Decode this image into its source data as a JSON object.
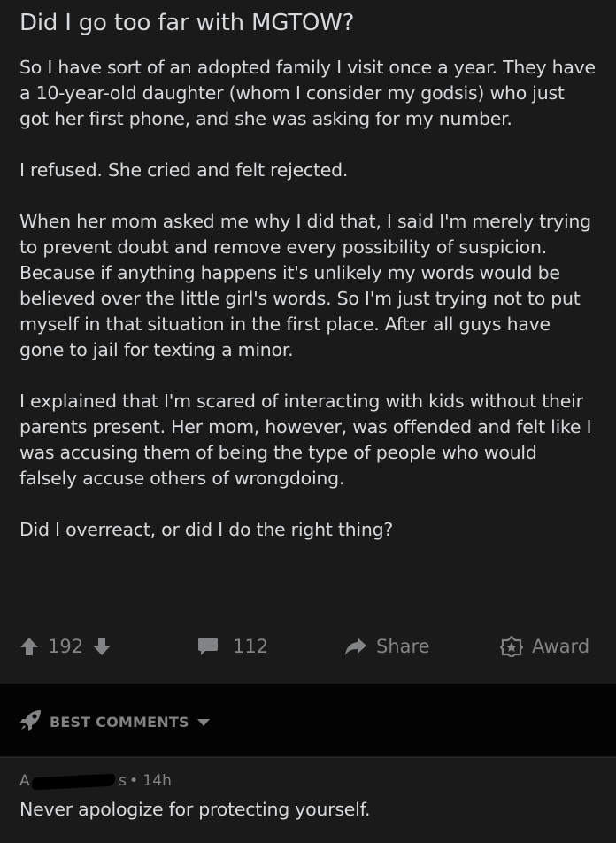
{
  "post": {
    "title": "Did I go too far with MGTOW?",
    "paragraphs": [
      "So I have sort of an adopted family I visit once a year. They have a 10-year-old daughter (whom I consider my godsis) who just got her first phone, and she was asking for my number.",
      "I refused. She cried and felt rejected.",
      "When her mom asked me why I did that, I said I'm merely trying to prevent doubt and remove every possibility of suspicion. Because if anything happens it's unlikely my words would be believed over the little girl's words. So I'm just trying not to put myself in that situation in the first place. After all guys have gone to jail for texting a minor.",
      "I explained that I'm scared of interacting with kids without their parents present. Her mom, however, was offended and felt like I was accusing them of being the type of people who would falsely accuse others of wrongdoing.",
      "Did I overreact, or did I do the right thing?"
    ]
  },
  "actions": {
    "score": "192",
    "comments": "112",
    "share_label": "Share",
    "award_label": "Award"
  },
  "sort": {
    "label": "BEST COMMENTS"
  },
  "comment": {
    "author_visible_start": "A",
    "author_visible_end": "s",
    "age": "• 14h",
    "text": "Never apologize for protecting yourself."
  },
  "colors": {
    "background": "#1a1a1b",
    "gap": "#030303",
    "text": "#d7dadc",
    "meta": "#818384"
  },
  "icons": [
    "upvote-icon",
    "downvote-icon",
    "comment-icon",
    "share-icon",
    "award-icon",
    "rocket-icon",
    "caret-down-icon"
  ]
}
